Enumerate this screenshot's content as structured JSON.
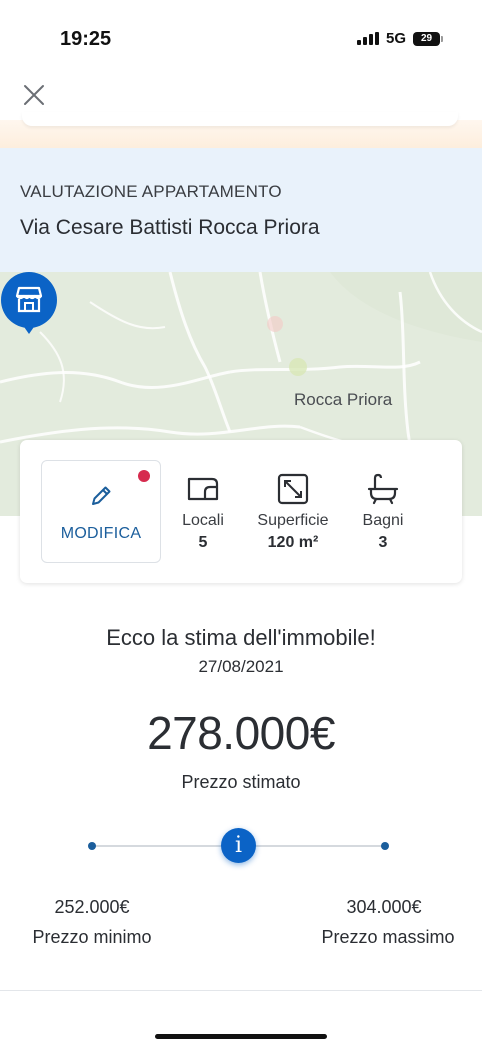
{
  "status_bar": {
    "time": "19:25",
    "network": "5G",
    "battery": "29"
  },
  "header": {
    "subtitle": "VALUTAZIONE APPARTAMENTO",
    "title": "Via Cesare Battisti Rocca Priora"
  },
  "map": {
    "place_label": "Rocca Priora",
    "pin_icon": "house-pin-icon",
    "pin_color": "#0b63c6"
  },
  "features": {
    "edit_label": "MODIFICA",
    "items": [
      {
        "icon": "rooms-icon",
        "label": "Locali",
        "value": "5"
      },
      {
        "icon": "surface-icon",
        "label": "Superficie",
        "value": "120 m²"
      },
      {
        "icon": "bathtub-icon",
        "label": "Bagni",
        "value": "3"
      }
    ]
  },
  "estimate": {
    "title": "Ecco la stima dell'immobile!",
    "date": "27/08/2021",
    "price": "278.000€",
    "price_label": "Prezzo stimato",
    "min_value": "252.000€",
    "min_label": "Prezzo minimo",
    "max_value": "304.000€",
    "max_label": "Prezzo massimo",
    "info_symbol": "i"
  },
  "colors": {
    "accent": "#0b63c6",
    "header_bg": "#e9f2fb",
    "notification_dot": "#d62b4e"
  }
}
